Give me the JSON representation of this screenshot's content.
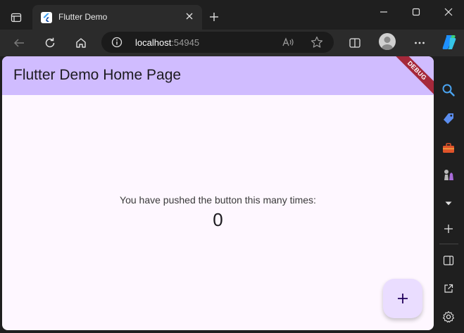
{
  "browser": {
    "tab": {
      "title": "Flutter Demo"
    },
    "address": {
      "host": "localhost",
      "port": ":54945"
    }
  },
  "app": {
    "title": "Flutter Demo Home Page",
    "debug_banner": "DEBUG",
    "counter_label": "You have pushed the button this many times:",
    "counter_value": "0",
    "colors": {
      "appbar": "#d0bcff",
      "body": "#fef7ff",
      "fab": "#eaddff",
      "debug_banner": "#a5283a"
    }
  },
  "icons": {
    "titlebar": [
      "tab-actions-icon",
      "flutter-logo-icon",
      "close-icon",
      "plus-icon",
      "minimize-icon",
      "maximize-icon",
      "close-icon"
    ],
    "toolbar": [
      "back-arrow-icon",
      "refresh-icon",
      "home-icon",
      "info-icon",
      "read-aloud-icon",
      "favorite-star-icon",
      "split-screen-icon",
      "profile-icon",
      "more-icon",
      "copilot-icon"
    ],
    "sidebar": [
      "search-icon",
      "tag-icon",
      "toolbox-icon",
      "chess-icon",
      "chevron-down-icon",
      "plus-icon",
      "panel-icon",
      "open-external-icon",
      "gear-icon"
    ]
  }
}
